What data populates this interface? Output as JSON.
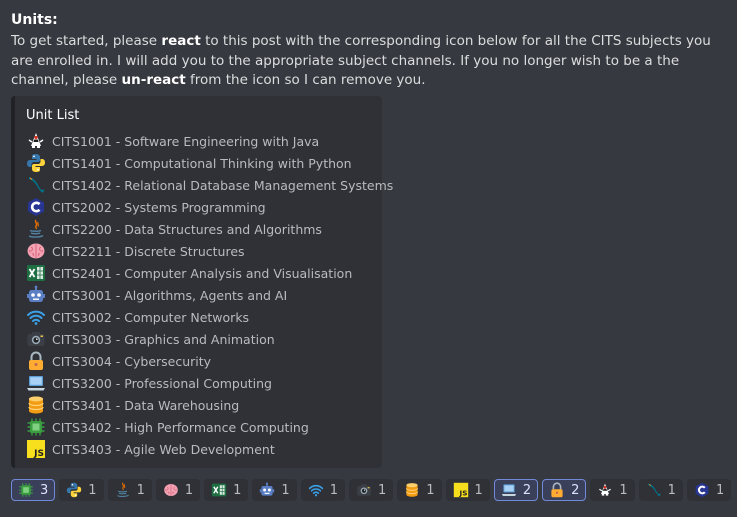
{
  "message": {
    "heading": "Units:",
    "intro_1": "To get started, please ",
    "intro_bold_1": "react",
    "intro_2": " to this post with the corresponding icon below for all the CITS subjects you are enrolled in. I will add you to the appropriate subject channels. If you no longer wish to be a the channel, please ",
    "intro_bold_2": "un-react",
    "intro_3": " from the icon so I can remove you."
  },
  "embed": {
    "title": "Unit List",
    "units": [
      {
        "icon": "java-duke-icon",
        "label": "CITS1001 - Software Engineering with Java"
      },
      {
        "icon": "python-icon",
        "label": "CITS1401 - Computational Thinking with Python"
      },
      {
        "icon": "mysql-dolphin-icon",
        "label": "CITS1402 - Relational Database Management Systems"
      },
      {
        "icon": "c-language-icon",
        "label": "CITS2002 - Systems Programming"
      },
      {
        "icon": "java-cup-icon",
        "label": "CITS2200 - Data Structures and Algorithms"
      },
      {
        "icon": "brain-icon",
        "label": "CITS2211 - Discrete Structures"
      },
      {
        "icon": "excel-icon",
        "label": "CITS2401 - Computer Analysis and Visualisation"
      },
      {
        "icon": "robot-icon",
        "label": "CITS3001 - Algorithms, Agents and AI"
      },
      {
        "icon": "wifi-icon",
        "label": "CITS3002 - Computer Networks"
      },
      {
        "icon": "camera-icon",
        "label": "CITS3003 - Graphics and Animation"
      },
      {
        "icon": "lock-icon",
        "label": "CITS3004 - Cybersecurity"
      },
      {
        "icon": "laptop-icon",
        "label": "CITS3200 - Professional Computing"
      },
      {
        "icon": "database-icon",
        "label": "CITS3401 - Data Warehousing"
      },
      {
        "icon": "chip-icon",
        "label": "CITS3402 - High Performance Computing"
      },
      {
        "icon": "javascript-icon",
        "label": "CITS3403 - Agile Web Development"
      }
    ]
  },
  "reactions": [
    {
      "icon": "chip-icon",
      "count": "3",
      "active": true
    },
    {
      "icon": "python-icon",
      "count": "1",
      "active": false
    },
    {
      "icon": "java-cup-icon",
      "count": "1",
      "active": false
    },
    {
      "icon": "brain-icon",
      "count": "1",
      "active": false
    },
    {
      "icon": "excel-icon",
      "count": "1",
      "active": false
    },
    {
      "icon": "robot-icon",
      "count": "1",
      "active": false
    },
    {
      "icon": "wifi-icon",
      "count": "1",
      "active": false
    },
    {
      "icon": "camera-icon",
      "count": "1",
      "active": false
    },
    {
      "icon": "database-icon",
      "count": "1",
      "active": false
    },
    {
      "icon": "javascript-icon",
      "count": "1",
      "active": false
    },
    {
      "icon": "laptop-icon",
      "count": "2",
      "active": true
    },
    {
      "icon": "lock-icon",
      "count": "2",
      "active": true
    },
    {
      "icon": "java-duke-icon",
      "count": "1",
      "active": false
    },
    {
      "icon": "mysql-dolphin-icon",
      "count": "1",
      "active": false
    },
    {
      "icon": "c-language-icon",
      "count": "1",
      "active": false
    }
  ]
}
